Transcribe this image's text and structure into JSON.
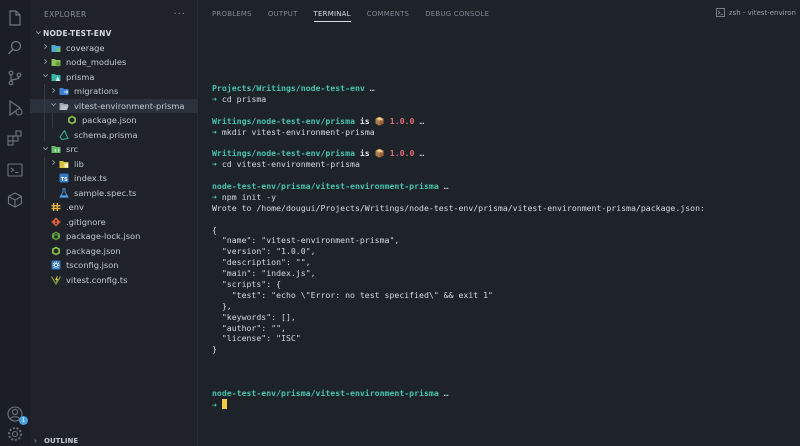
{
  "sidebar": {
    "title": "EXPLORER",
    "more": "···",
    "tree": [
      {
        "label": "NODE-TEST-ENV",
        "depth": 0,
        "chev": "down",
        "icon": "none",
        "root": true
      },
      {
        "label": "coverage",
        "depth": 1,
        "chev": "right",
        "icon": "folder-coverage-icon"
      },
      {
        "label": "node_modules",
        "depth": 1,
        "chev": "right",
        "icon": "folder-node-icon"
      },
      {
        "label": "prisma",
        "depth": 1,
        "chev": "down",
        "icon": "folder-prisma-icon"
      },
      {
        "label": "migrations",
        "depth": 2,
        "chev": "right",
        "icon": "folder-migrations-icon"
      },
      {
        "label": "vitest-environment-prisma",
        "depth": 2,
        "chev": "down",
        "icon": "folder-open-icon",
        "selected": true
      },
      {
        "label": "package.json",
        "depth": 3,
        "chev": "none",
        "icon": "package-json-icon"
      },
      {
        "label": "schema.prisma",
        "depth": 2,
        "chev": "none",
        "icon": "prisma-file-icon"
      },
      {
        "label": "src",
        "depth": 1,
        "chev": "down",
        "icon": "folder-src-icon"
      },
      {
        "label": "lib",
        "depth": 2,
        "chev": "right",
        "icon": "folder-lib-icon"
      },
      {
        "label": "index.ts",
        "depth": 2,
        "chev": "none",
        "icon": "typescript-file-icon"
      },
      {
        "label": "sample.spec.ts",
        "depth": 2,
        "chev": "none",
        "icon": "test-file-icon"
      },
      {
        "label": ".env",
        "depth": 1,
        "chev": "none",
        "icon": "env-file-icon"
      },
      {
        "label": ".gitignore",
        "depth": 1,
        "chev": "none",
        "icon": "git-file-icon"
      },
      {
        "label": "package-lock.json",
        "depth": 1,
        "chev": "none",
        "icon": "package-lock-icon"
      },
      {
        "label": "package.json",
        "depth": 1,
        "chev": "none",
        "icon": "package-json-icon"
      },
      {
        "label": "tsconfig.json",
        "depth": 1,
        "chev": "none",
        "icon": "tsconfig-icon"
      },
      {
        "label": "vitest.config.ts",
        "depth": 1,
        "chev": "none",
        "icon": "vitest-icon"
      }
    ],
    "outline_label": "OUTLINE",
    "account_badge": "1"
  },
  "activity": {
    "icons": [
      "files-icon",
      "search-icon",
      "source-control-icon",
      "run-debug-icon",
      "extensions-icon",
      "terminal-icon",
      "package-icon",
      "account-icon",
      "settings-icon"
    ]
  },
  "panel": {
    "tabs": [
      {
        "label": "PROBLEMS",
        "active": false
      },
      {
        "label": "OUTPUT",
        "active": false
      },
      {
        "label": "TERMINAL",
        "active": true
      },
      {
        "label": "COMMENTS",
        "active": false
      },
      {
        "label": "DEBUG CONSOLE",
        "active": false
      }
    ],
    "terminal_selector": "zsh - vitest-environ"
  },
  "terminal": {
    "lines": [
      [
        {
          "c": "path",
          "t": "Projects/Writings/node-test-env"
        },
        {
          "c": "ell",
          "t": " …"
        }
      ],
      [
        {
          "c": "arrow",
          "t": "➜"
        },
        {
          "c": "",
          "t": " cd prisma"
        }
      ],
      [],
      [
        {
          "c": "path",
          "t": "Writings/node-test-env/prisma"
        },
        {
          "c": "is",
          "t": " is "
        },
        {
          "c": "",
          "t": "📦"
        },
        {
          "c": "ver",
          "t": " 1.0.0"
        },
        {
          "c": "ell",
          "t": " …"
        }
      ],
      [
        {
          "c": "arrow",
          "t": "➜"
        },
        {
          "c": "",
          "t": " mkdir vitest-environment-prisma"
        }
      ],
      [],
      [
        {
          "c": "path",
          "t": "Writings/node-test-env/prisma"
        },
        {
          "c": "is",
          "t": " is "
        },
        {
          "c": "",
          "t": "📦"
        },
        {
          "c": "ver",
          "t": " 1.0.0"
        },
        {
          "c": "ell",
          "t": " …"
        }
      ],
      [
        {
          "c": "arrow",
          "t": "➜"
        },
        {
          "c": "",
          "t": " cd vitest-environment-prisma"
        }
      ],
      [],
      [
        {
          "c": "path",
          "t": "node-test-env/prisma/vitest-environment-prisma"
        },
        {
          "c": "ell",
          "t": " …"
        }
      ],
      [
        {
          "c": "arrow",
          "t": "➜"
        },
        {
          "c": "",
          "t": " npm init -y"
        }
      ],
      [
        {
          "c": "",
          "t": "Wrote to /home/dougui/Projects/Writings/node-test-env/prisma/vitest-environment-prisma/package.json:"
        }
      ],
      [],
      [
        {
          "c": "",
          "t": "{"
        }
      ],
      [
        {
          "c": "",
          "t": "  \"name\": \"vitest-environment-prisma\","
        }
      ],
      [
        {
          "c": "",
          "t": "  \"version\": \"1.0.0\","
        }
      ],
      [
        {
          "c": "",
          "t": "  \"description\": \"\","
        }
      ],
      [
        {
          "c": "",
          "t": "  \"main\": \"index.js\","
        }
      ],
      [
        {
          "c": "",
          "t": "  \"scripts\": {"
        }
      ],
      [
        {
          "c": "",
          "t": "    \"test\": \"echo \\\"Error: no test specified\\\" && exit 1\""
        }
      ],
      [
        {
          "c": "",
          "t": "  },"
        }
      ],
      [
        {
          "c": "",
          "t": "  \"keywords\": [],"
        }
      ],
      [
        {
          "c": "",
          "t": "  \"author\": \"\","
        }
      ],
      [
        {
          "c": "",
          "t": "  \"license\": \"ISC\""
        }
      ],
      [
        {
          "c": "",
          "t": "}"
        }
      ],
      [],
      [],
      [],
      [
        {
          "c": "path",
          "t": "node-test-env/prisma/vitest-environment-prisma"
        },
        {
          "c": "ell",
          "t": " …"
        }
      ],
      [
        {
          "c": "arrow",
          "t": "➜"
        },
        {
          "c": "",
          "t": " "
        },
        {
          "c": "cursor",
          "t": ""
        }
      ]
    ]
  }
}
